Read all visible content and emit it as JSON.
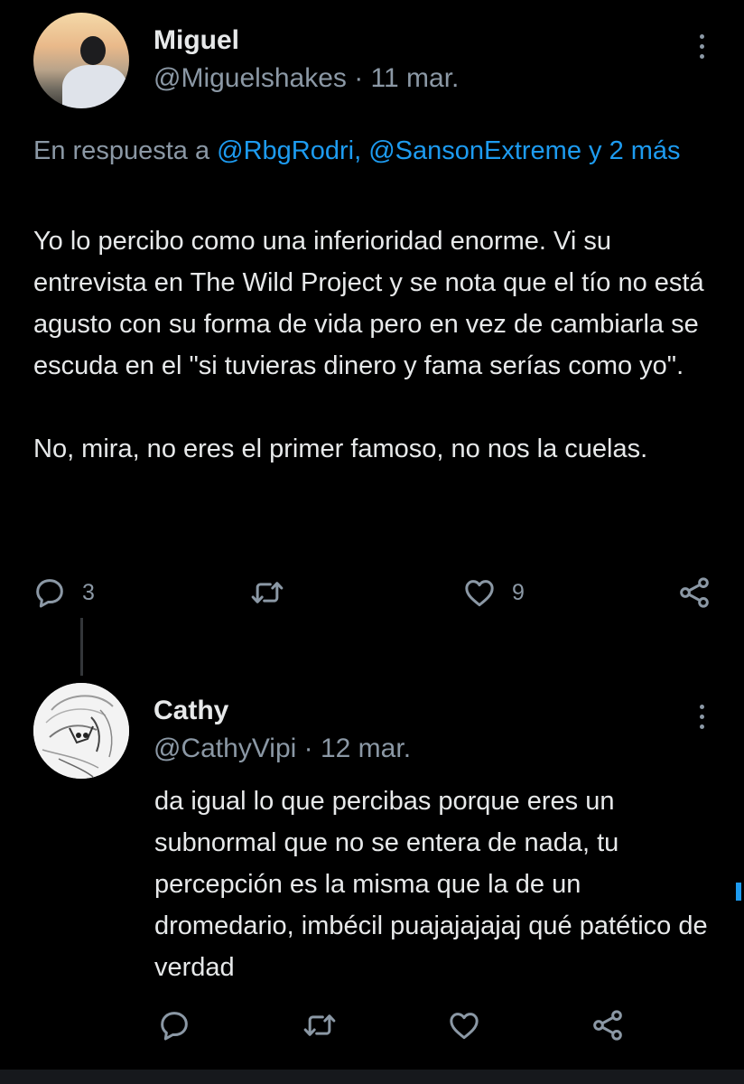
{
  "tweets": [
    {
      "name": "Miguel",
      "handle": "@Miguelshakes",
      "date": "· 11 mar.",
      "reply_prefix": "En respuesta a ",
      "reply_users": "@RbgRodri, @SansonExtreme y 2 más",
      "text": "Yo lo percibo como una inferioridad enorme. Vi su entrevista en The Wild Project y se nota que el tío no está agusto con su forma de vida pero en vez de cambiarla se escuda en el \"si tuvieras dinero y fama serías como yo\".\n\nNo, mira, no eres el primer famoso, no nos la cuelas.",
      "replies": "3",
      "retweets": "",
      "likes": "9"
    },
    {
      "name": "Cathy",
      "handle": "@CathyVipi",
      "date": "· 12 mar.",
      "text": "da igual lo que percibas porque eres un subnormal que no se entera de nada, tu percepción es la misma que la de un dromedario, imbécil puajajajajaj qué patético de verdad"
    }
  ],
  "icons": {
    "reply": "speech-bubble-icon",
    "retweet": "retweet-icon",
    "like": "heart-icon",
    "share": "share-icon",
    "more": "more-vertical-icon"
  },
  "colors": {
    "background": "#000000",
    "text": "#e7e9ea",
    "secondary": "#8b98a5",
    "link": "#1d9bf0"
  }
}
